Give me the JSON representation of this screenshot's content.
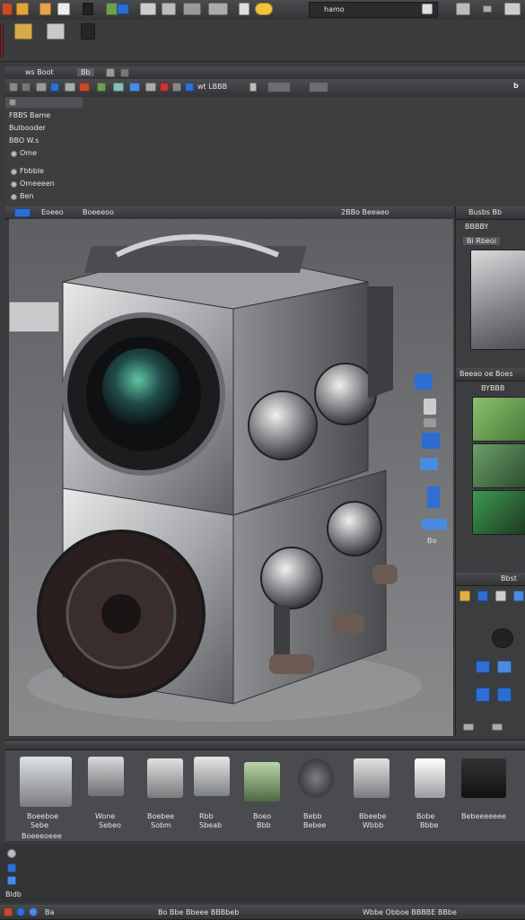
{
  "topbar": {
    "search_text": "hamo",
    "icons": [
      "app-icon",
      "folder-icon",
      "pen-icon",
      "doc-icon",
      "paint-icon",
      "layers-icon",
      "palette-icon",
      "gear-icon",
      "camera-icon",
      "star-icon"
    ]
  },
  "secondbar": {
    "icons": [
      "folder-icon",
      "image-icon",
      "save-icon"
    ]
  },
  "menubar": {
    "title": "ws Boot",
    "tag": "Bb"
  },
  "toolbar": {
    "text": "wt LBBB",
    "right_icon": "b"
  },
  "props_panel": {
    "header": "FBBS Bame",
    "items": [
      "Bulbooder",
      "BBO W.s",
      "Ome",
      "Fbbble",
      "Omeeeen",
      "Ben"
    ]
  },
  "viewport": {
    "tab_left": "Eoeeo",
    "tab_mid": "Boeeeoo",
    "tab_right": "2BBo Beeaeo"
  },
  "right_panel": {
    "header": "Busbs Bb",
    "tab1": "BBBBY",
    "tab2": "Bi Rbeoi",
    "section2_title": "Beeao oe Boes",
    "section2_sub": "BYBBB",
    "section3_label": "Bbst"
  },
  "side_labels": [
    "Bo"
  ],
  "bottom_strip": {
    "label_left": "Boeeeoeee",
    "items": [
      {
        "name": "Boeeboe",
        "sub": "Sebe"
      },
      {
        "name": "Wone",
        "sub": "Sebeo"
      },
      {
        "name": "Boebee",
        "sub": "Sobm"
      },
      {
        "name": "Rbb",
        "sub": "Sbeab"
      },
      {
        "name": "Boeo",
        "sub": "Bbb"
      },
      {
        "name": "Bebb",
        "sub": "Bebee"
      },
      {
        "name": "Bbeebe",
        "sub": "Wbbb"
      },
      {
        "name": "Bobe",
        "sub": "Bbbe"
      },
      {
        "name": "Bebeeeeeee",
        "sub": ""
      }
    ]
  },
  "left_bottom": {
    "label": "Bldb"
  },
  "statusbar": {
    "left": "Ba",
    "center": "Bo Bbe Bbeee BBBbeb",
    "right": "Wbbe Obboe BBBBE BBbe"
  },
  "colors": {
    "accent": "#2f6fd4",
    "chrome": "#3a3b3d",
    "viewport_bg": "#6c6d6f"
  }
}
